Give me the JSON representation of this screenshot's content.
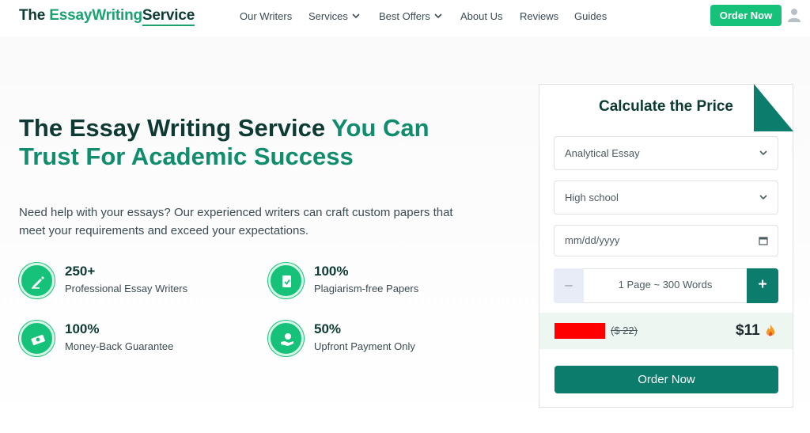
{
  "header": {
    "logo": {
      "part1": "The ",
      "part2": "EssayWriting",
      "part3": "Service"
    },
    "nav": [
      {
        "label": "Our Writers"
      },
      {
        "label": "Services"
      },
      {
        "label": "Best Offers"
      },
      {
        "label": "About Us"
      },
      {
        "label": "Reviews"
      },
      {
        "label": "Guides"
      }
    ],
    "order_button": "Order Now"
  },
  "hero": {
    "title_main": "The Essay Writing Service ",
    "title_accent": "You Can Trust For Academic Success",
    "subtitle": "Need help with your essays? Our experienced writers can craft custom papers that meet your requirements and exceed your expectations.",
    "features": [
      {
        "value": "250+",
        "label": "Professional Essay Writers",
        "icon": "writer-icon"
      },
      {
        "value": "100%",
        "label": "Plagiarism-free Papers",
        "icon": "document-check-icon"
      },
      {
        "value": "100%",
        "label": "Money-Back Guarantee",
        "icon": "money-back-icon"
      },
      {
        "value": "50%",
        "label": "Upfront Payment Only",
        "icon": "hand-coin-icon"
      }
    ]
  },
  "calculator": {
    "title": "Calculate the Price",
    "paper_type": "Analytical Essay",
    "academic_level": "High school",
    "deadline_placeholder": "mm/dd/yyyy",
    "pages": "1 Page ~ 300 Words",
    "minus": "–",
    "plus": "+",
    "old_price": "($ 22)",
    "new_price": "$11",
    "order_button": "Order Now"
  },
  "colors": {
    "brand_dark": "#0d3b33",
    "brand_green": "#16c27a",
    "teal": "#0c7c6c",
    "accent_text": "#0f8d6c"
  }
}
